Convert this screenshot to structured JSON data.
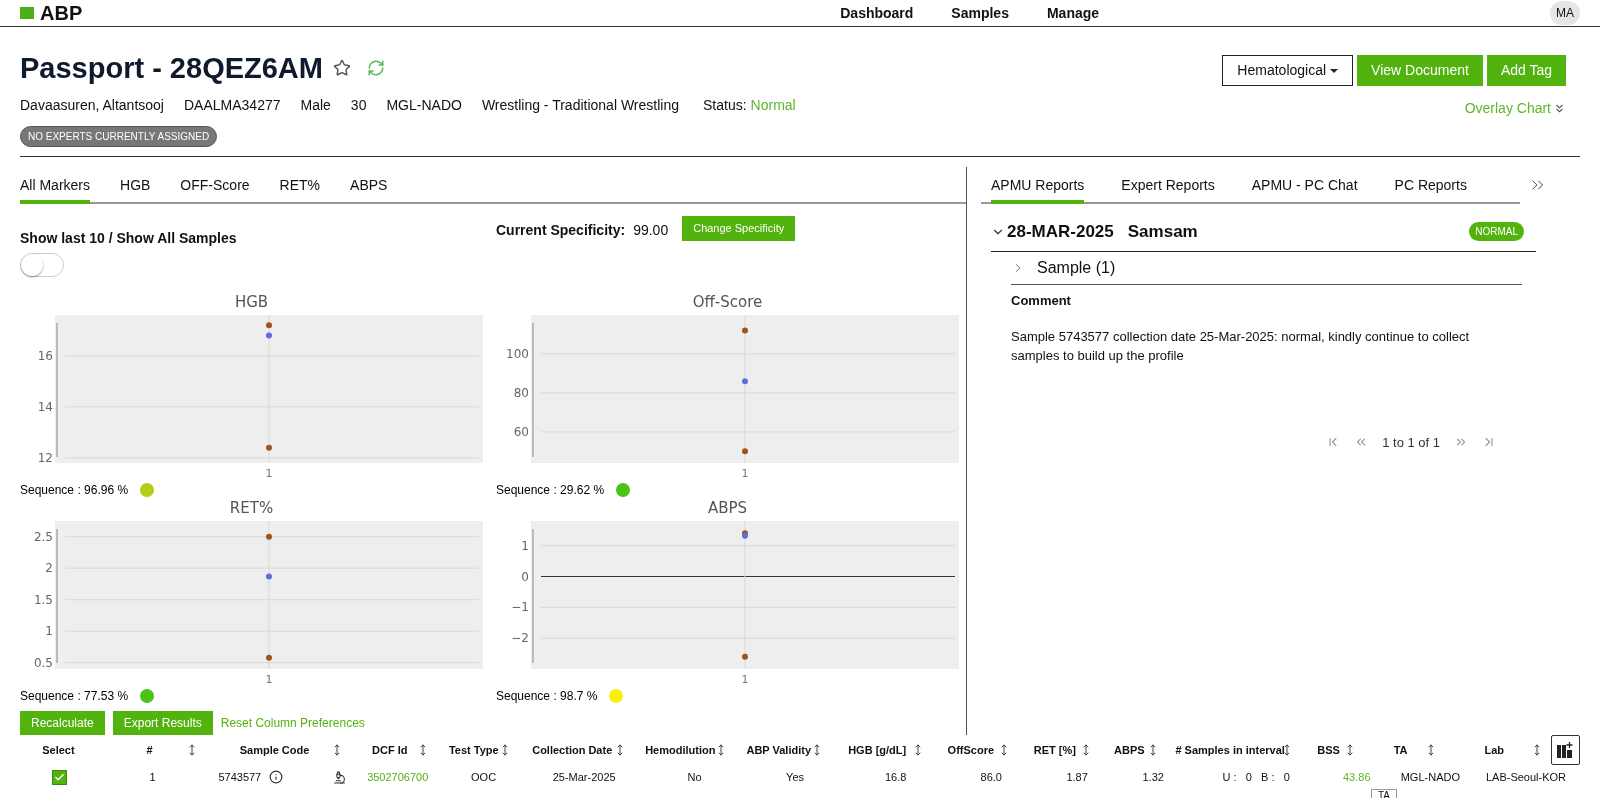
{
  "header": {
    "logo": "ABP",
    "nav": [
      {
        "label": "Dashboard"
      },
      {
        "label": "Samples"
      },
      {
        "label": "Manage"
      }
    ],
    "avatar": "MA"
  },
  "passport": {
    "title": "Passport - 28QEZ6AM",
    "starred": false,
    "info": [
      "Davaasuren, Altantsooj",
      "DAALMA34277",
      "Male",
      "30",
      "MGL-NADO",
      "Wrestling - Traditional Wrestling"
    ],
    "status_label": "Status:",
    "status": "Normal",
    "badge": "NO EXPERTS CURRENTLY ASSIGNED",
    "dropdown": "Hematological",
    "buttons": [
      "View Document",
      "Add Tag"
    ],
    "overlay_link": "Overlay Chart"
  },
  "marker_tabs": [
    {
      "label": "All Markers",
      "selected": true
    },
    {
      "label": "HGB",
      "selected": false
    },
    {
      "label": "OFF-Score",
      "selected": false
    },
    {
      "label": "RET%",
      "selected": false
    },
    {
      "label": "ABPS",
      "selected": false
    }
  ],
  "show_label": "Show last 10 / Show All Samples",
  "show_all": {
    "on": false
  },
  "specificity": {
    "label": "Current Specificity:",
    "value": "99.00",
    "button": "Change Specificity"
  },
  "charts": [
    {
      "sequence": "Sequence : 96.96 %",
      "color": "#b5cc18",
      "chart_data": {
        "type": "scatter",
        "title": "HGB",
        "grid": true,
        "categories": [
          "1"
        ],
        "ylim": [
          11.8,
          17.6
        ],
        "yticks": [
          12,
          14,
          16
        ],
        "series": [
          {
            "color": "#a0521a",
            "values": [
              17.2
            ]
          },
          {
            "color": "#5b6ee1",
            "values": [
              16.8
            ]
          },
          {
            "color": "#a0521a",
            "values": [
              12.4
            ]
          }
        ]
      }
    },
    {
      "sequence": "Sequence : 29.62 %",
      "color": "#4cc417",
      "chart_data": {
        "type": "scatter",
        "title": "Off-Score",
        "grid": true,
        "categories": [
          "1"
        ],
        "ylim": [
          44,
          120
        ],
        "yticks": [
          60,
          80,
          100
        ],
        "series": [
          {
            "color": "#a0521a",
            "values": [
              112
            ]
          },
          {
            "color": "#5b6ee1",
            "values": [
              86
            ]
          },
          {
            "color": "#a0521a",
            "values": [
              50
            ]
          }
        ]
      }
    },
    {
      "sequence": "Sequence : 77.53 %",
      "color": "#4cc417",
      "chart_data": {
        "type": "scatter",
        "title": "RET%",
        "grid": true,
        "categories": [
          "1"
        ],
        "ylim": [
          0.4,
          2.75
        ],
        "yticks": [
          0.5,
          1,
          1.5,
          2,
          2.5
        ],
        "series": [
          {
            "color": "#a0521a",
            "values": [
              2.5
            ]
          },
          {
            "color": "#5b6ee1",
            "values": [
              1.87
            ]
          },
          {
            "color": "#a0521a",
            "values": [
              0.58
            ]
          }
        ]
      }
    },
    {
      "sequence": "Sequence : 98.7 %",
      "color": "#f5ef0a",
      "chart_data": {
        "type": "scatter",
        "title": "ABPS",
        "grid": true,
        "categories": [
          "1"
        ],
        "ylim": [
          -3,
          1.8
        ],
        "yticks": [
          {
            "value": -2,
            "label": "−2"
          },
          {
            "value": -1,
            "label": "−1"
          },
          {
            "value": 0,
            "label": "0"
          },
          {
            "value": 1,
            "label": "1"
          }
        ],
        "series": [
          {
            "color": "#a0521a",
            "values": [
              1.4
            ]
          },
          {
            "color": "#5b6ee1",
            "values": [
              1.32
            ]
          },
          {
            "color": "#a0521a",
            "values": [
              -2.6
            ]
          }
        ]
      }
    }
  ],
  "actions": {
    "buttons": [
      "Recalculate",
      "Export Results"
    ],
    "link": "Reset Column Preferences"
  },
  "report_tabs": [
    {
      "label": "APMU Reports",
      "selected": true
    },
    {
      "label": "Expert Reports",
      "selected": false
    },
    {
      "label": "APMU - PC Chat",
      "selected": false
    },
    {
      "label": "PC Reports",
      "selected": false
    }
  ],
  "report": {
    "expanded": true,
    "date": "28-MAR-2025",
    "author": "Samsam",
    "status": "NORMAL",
    "sample": {
      "label": "Sample (1)",
      "expanded": false
    },
    "comment_label": "Comment",
    "comment": "Sample 5743577 collection date 25-Mar-2025: normal, kindly continue to collect samples to build up the profile"
  },
  "pagination": "1 to 1 of 1",
  "table": {
    "columns": [
      {
        "label": "Select",
        "sortable": false
      },
      {
        "label": "#",
        "sortable": true
      },
      {
        "label": "Sample Code",
        "sortable": true
      },
      {
        "label": "DCF Id",
        "sortable": true
      },
      {
        "label": "Test Type",
        "sortable": true
      },
      {
        "label": "Collection Date",
        "sortable": true
      },
      {
        "label": "Hemodilution",
        "sortable": true
      },
      {
        "label": "ABP Validity",
        "sortable": true
      },
      {
        "label": "HGB [g/dL]",
        "sortable": true
      },
      {
        "label": "OffScore",
        "sortable": true
      },
      {
        "label": "RET [%]",
        "sortable": true
      },
      {
        "label": "ABPS",
        "sortable": true
      },
      {
        "label": "# Samples in interval",
        "sortable": true
      },
      {
        "label": "BSS",
        "sortable": true
      },
      {
        "label": "TA",
        "sortable": true
      },
      {
        "label": "Lab",
        "sortable": true
      }
    ],
    "rows": [
      {
        "cells": [
          {
            "kind": "checkbox",
            "checked": true
          },
          {
            "text": "1",
            "kind": "text"
          },
          {
            "text": "5743577",
            "kind": "sample"
          },
          {
            "text": "3502706700",
            "kind": "link"
          },
          {
            "text": "OOC",
            "kind": "text"
          },
          {
            "text": "25-Mar-2025",
            "kind": "text"
          },
          {
            "text": "No",
            "kind": "text"
          },
          {
            "text": "Yes",
            "kind": "text"
          },
          {
            "text": "16.8",
            "kind": "text"
          },
          {
            "text": "86.0",
            "kind": "text"
          },
          {
            "text": "1.87",
            "kind": "text"
          },
          {
            "text": "1.32",
            "kind": "text"
          },
          {
            "text": "U :   0   B :   0",
            "kind": "text"
          },
          {
            "text": "43.86",
            "kind": "score"
          },
          {
            "text": "MGL-NADO",
            "kind": "text"
          },
          {
            "text": "LAB-Seoul-KOR",
            "kind": "text"
          }
        ]
      }
    ]
  },
  "tooltip": "TA"
}
